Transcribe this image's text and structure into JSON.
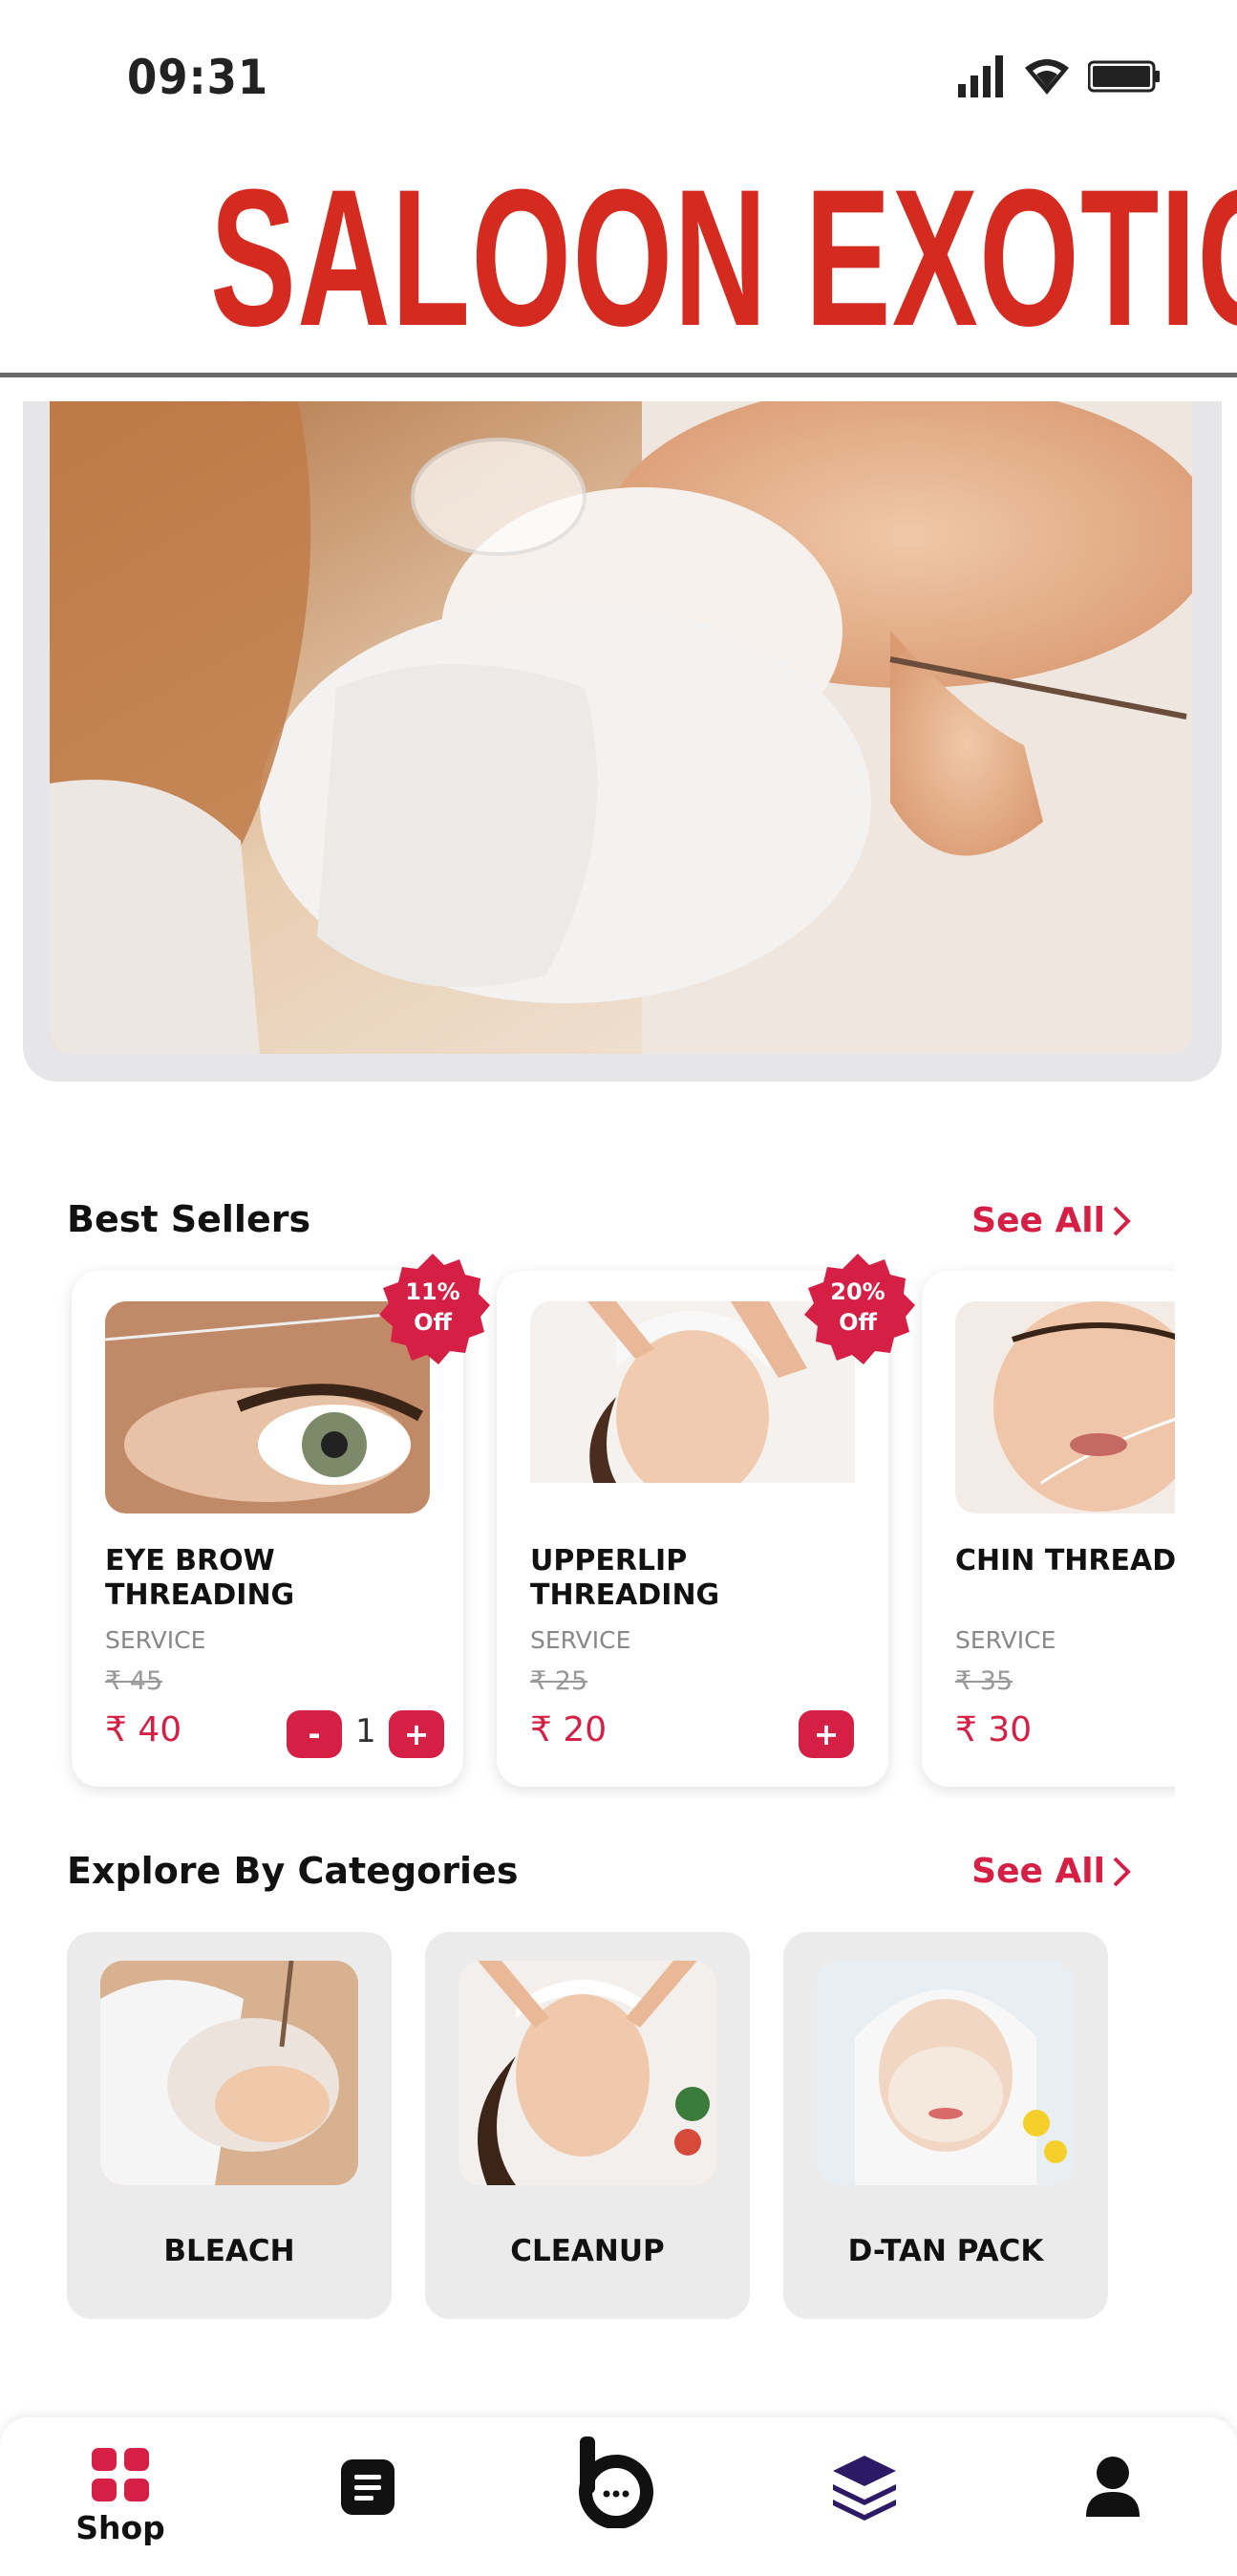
{
  "status_bar": {
    "time": "09:31",
    "icons": [
      "signal-icon",
      "wifi-icon",
      "battery-icon"
    ]
  },
  "header": {
    "title": "SALOON EXOTIC",
    "title_color": "#d42a20"
  },
  "best_sellers": {
    "title": "Best Sellers",
    "see_all": "See All",
    "products": [
      {
        "name": "EYE BROW\nTHREADING",
        "type": "SERVICE",
        "old_price": "₹ 45",
        "price": "₹ 40",
        "badge": "11%\nOff",
        "quantity": "1"
      },
      {
        "name": "UPPERLIP\nTHREADING",
        "type": "SERVICE",
        "old_price": "₹ 25",
        "price": "₹ 20",
        "badge": "20%\nOff"
      },
      {
        "name": "CHIN THREADING",
        "type": "SERVICE",
        "old_price": "₹ 35",
        "price": "₹ 30"
      }
    ],
    "minus": "-",
    "plus": "+"
  },
  "categories": {
    "title": "Explore By Categories",
    "see_all": "See All",
    "items": [
      {
        "label": "BLEACH"
      },
      {
        "label": "CLEANUP"
      },
      {
        "label": "D-TAN PACK"
      }
    ]
  },
  "bottom_nav": {
    "items": [
      {
        "label": "Shop",
        "icon": "grid-icon"
      },
      {
        "label": "",
        "icon": "orders-icon"
      },
      {
        "label": "",
        "icon": "brand-chat-icon"
      },
      {
        "label": "",
        "icon": "layers-icon"
      },
      {
        "label": "",
        "icon": "profile-icon"
      }
    ]
  },
  "colors": {
    "accent": "#d61f45",
    "title": "#d42a20",
    "card_bg": "#ebebeb"
  }
}
